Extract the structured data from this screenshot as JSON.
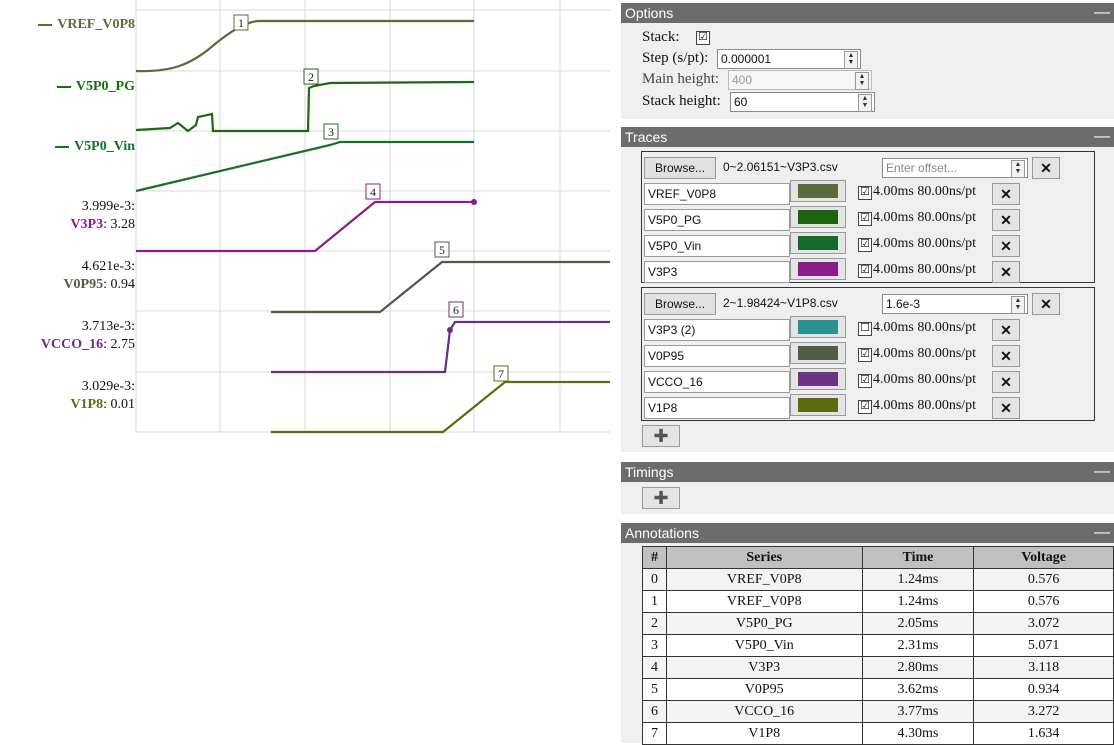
{
  "plot": {
    "traces": [
      {
        "name": "VREF_V0P8",
        "color": "#5b6b3e",
        "label_color": "#5b6b3e",
        "prefix": "",
        "value": ""
      },
      {
        "name": "V5P0_PG",
        "color": "#1b6a12",
        "label_color": "#1b6a12",
        "prefix": "",
        "value": ""
      },
      {
        "name": "V5P0_Vin",
        "color": "#16702a",
        "label_color": "#16702a",
        "prefix": "",
        "value": ""
      },
      {
        "name": "V3P3",
        "color": "#8b1c8b",
        "label_color": "#8b1c8b",
        "prefix": "3.999e-3:",
        "value": ": 3.28"
      },
      {
        "name": "V0P95",
        "color": "#4e5c48",
        "label_color": "#4e5c48",
        "prefix": "4.621e-3:",
        "value": ": 0.94"
      },
      {
        "name": "VCCO_16",
        "color": "#6c2f80",
        "label_color": "#6c2f80",
        "prefix": "3.713e-3:",
        "value": ": 2.75"
      },
      {
        "name": "V1P8",
        "color": "#5f6b10",
        "label_color": "#5f6b10",
        "prefix": "3.029e-3:",
        "value": ": 0.01"
      }
    ],
    "markers": [
      "1",
      "2",
      "3",
      "4",
      "5",
      "6",
      "7"
    ]
  },
  "options": {
    "title": "Options",
    "collapse": "—",
    "stack_label": "Stack:",
    "stack_checked": "☑",
    "step_label": "Step (s/pt):",
    "step_value": "0.000001",
    "main_height_label": "Main height:",
    "main_height_value": "400",
    "stack_height_label": "Stack height:",
    "stack_height_value": "60"
  },
  "traces_panel": {
    "title": "Traces",
    "collapse": "—",
    "groups": [
      {
        "browse": "Browse...",
        "file": "0~2.06151~V3P3.csv",
        "offset_placeholder": "Enter offset...",
        "offset_value": "",
        "remove": "✕",
        "rows": [
          {
            "name": "VREF_V0P8",
            "color": "#5b6b3e",
            "checked": "☑",
            "meta": "4.00ms 80.00ns/pt",
            "remove": "✕"
          },
          {
            "name": "V5P0_PG",
            "color": "#1e6410",
            "checked": "☑",
            "meta": "4.00ms 80.00ns/pt",
            "remove": "✕"
          },
          {
            "name": "V5P0_Vin",
            "color": "#186a28",
            "checked": "☑",
            "meta": "4.00ms 80.00ns/pt",
            "remove": "✕"
          },
          {
            "name": "V3P3",
            "color": "#8b1c8b",
            "checked": "☑",
            "meta": "4.00ms 80.00ns/pt",
            "remove": "✕"
          }
        ]
      },
      {
        "browse": "Browse...",
        "file": "2~1.98424~V1P8.csv",
        "offset_placeholder": "",
        "offset_value": "1.6e-3",
        "remove": "✕",
        "rows": [
          {
            "name": "V3P3 (2)",
            "color": "#2b9090",
            "checked": "☐",
            "meta": "4.00ms 80.00ns/pt",
            "remove": "✕"
          },
          {
            "name": "V0P95",
            "color": "#4e5c48",
            "checked": "☑",
            "meta": "4.00ms 80.00ns/pt",
            "remove": "✕"
          },
          {
            "name": "VCCO_16",
            "color": "#6c3480",
            "checked": "☑",
            "meta": "4.00ms 80.00ns/pt",
            "remove": "✕"
          },
          {
            "name": "V1P8",
            "color": "#5f6b10",
            "checked": "☑",
            "meta": "4.00ms 80.00ns/pt",
            "remove": "✕"
          }
        ]
      }
    ],
    "add": "✚"
  },
  "timings": {
    "title": "Timings",
    "collapse": "—",
    "add": "✚"
  },
  "annotations": {
    "title": "Annotations",
    "collapse": "—",
    "columns": [
      "#",
      "Series",
      "Time",
      "Voltage"
    ],
    "rows": [
      [
        "0",
        "VREF_V0P8",
        "1.24ms",
        "0.576"
      ],
      [
        "1",
        "VREF_V0P8",
        "1.24ms",
        "0.576"
      ],
      [
        "2",
        "V5P0_PG",
        "2.05ms",
        "3.072"
      ],
      [
        "3",
        "V5P0_Vin",
        "2.31ms",
        "5.071"
      ],
      [
        "4",
        "V3P3",
        "2.80ms",
        "3.118"
      ],
      [
        "5",
        "V0P95",
        "3.62ms",
        "0.934"
      ],
      [
        "6",
        "VCCO_16",
        "3.77ms",
        "3.272"
      ],
      [
        "7",
        "V1P8",
        "4.30ms",
        "1.634"
      ]
    ]
  }
}
